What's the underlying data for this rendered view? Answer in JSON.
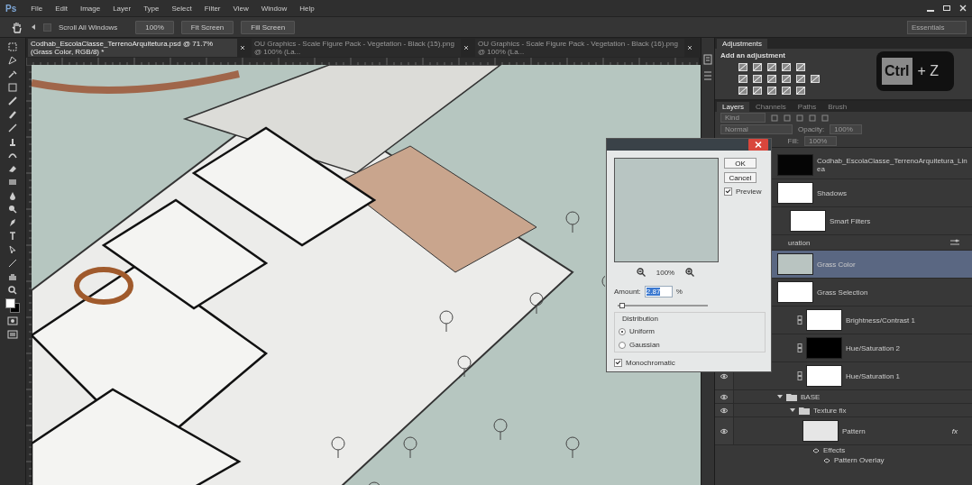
{
  "app": {
    "logo": "Ps",
    "menu": [
      "File",
      "Edit",
      "Image",
      "Layer",
      "Type",
      "Select",
      "Filter",
      "View",
      "Window",
      "Help"
    ]
  },
  "options_bar": {
    "scroll_all": {
      "label": "Scroll All Windows",
      "checked": false
    },
    "buttons": [
      "100%",
      "Fit Screen",
      "Fill Screen"
    ],
    "workspace": "Essentials"
  },
  "document_tabs": [
    {
      "label": "Codhab_EscolaClasse_TerrenoArquitetura.psd @ 71.7% (Grass Color, RGB/8) *",
      "selected": true
    },
    {
      "label": "OU Graphics - Scale Figure Pack - Vegetation - Black (15).png @ 100% (La...",
      "selected": false
    },
    {
      "label": "OU Graphics - Scale Figure Pack - Vegetation - Black (16).png @ 100% (La...",
      "selected": false
    }
  ],
  "adjustments": {
    "tab": "Adjustments",
    "heading": "Add an adjustment"
  },
  "shortcut_overlay": {
    "key": "Ctrl",
    "rest": "+ Z"
  },
  "layers_panel": {
    "tabs": [
      {
        "label": "Layers",
        "selected": true
      },
      {
        "label": "Channels",
        "selected": false
      },
      {
        "label": "Paths",
        "selected": false
      },
      {
        "label": "Brush",
        "selected": false
      }
    ],
    "filter": "Kind",
    "blend_mode": "Normal",
    "opacity_label": "Opacity:",
    "opacity": "100%",
    "fill_label": "Fill:",
    "fill": "100%",
    "layers": [
      {
        "kind": "layer",
        "name": "Codhab_EscolaClasse_TerrenoArquitetura_Linea",
        "color": "#050505",
        "selected": false
      },
      {
        "kind": "layer",
        "name": "Shadows",
        "color": "#ffffff",
        "selected": false,
        "children": [
          {
            "kind": "layer",
            "name": "Smart Filters",
            "color": "#ffffff",
            "selected": false
          },
          {
            "kind": "filter",
            "name": "uration",
            "selected": false
          }
        ]
      },
      {
        "kind": "layer",
        "name": "Grass Color",
        "color": "#b9c4c1",
        "selected": true
      },
      {
        "kind": "layer",
        "name": "Grass Selection",
        "color": "#ffffff",
        "selected": false
      },
      {
        "kind": "adjustment",
        "name": "Brightness/Contrast 1",
        "color": "#ffffff",
        "selected": false
      },
      {
        "kind": "adjustment",
        "name": "Hue/Saturation 2",
        "color": "#000000",
        "selected": false
      },
      {
        "kind": "adjustment",
        "name": "Hue/Saturation 1",
        "color": "#ffffff",
        "selected": false,
        "visible": true
      },
      {
        "kind": "group",
        "name": "BASE",
        "expanded": true,
        "visible": true,
        "selected": false,
        "children": [
          {
            "kind": "group",
            "name": "Texture fix",
            "expanded": true,
            "visible": true,
            "selected": false,
            "children": [
              {
                "kind": "layer",
                "name": "Pattern",
                "color": "#e6e6e6",
                "visible": true,
                "fx": "fx",
                "selected": false,
                "effects": [
                  "Effects",
                  "Pattern Overlay"
                ]
              }
            ]
          }
        ]
      }
    ]
  },
  "add_noise_dialog": {
    "zoom": "100%",
    "ok": "OK",
    "cancel": "Cancel",
    "preview": {
      "label": "Preview",
      "checked": true
    },
    "amount_label": "Amount:",
    "amount": "2.87",
    "amount_unit": "%",
    "amount_slider": {
      "level": 0.05
    },
    "distribution_label": "Distribution",
    "distribution": [
      {
        "label": "Uniform",
        "selected": true
      },
      {
        "label": "Gaussian",
        "selected": false
      }
    ],
    "monochromatic": {
      "label": "Monochromatic",
      "checked": true
    }
  }
}
